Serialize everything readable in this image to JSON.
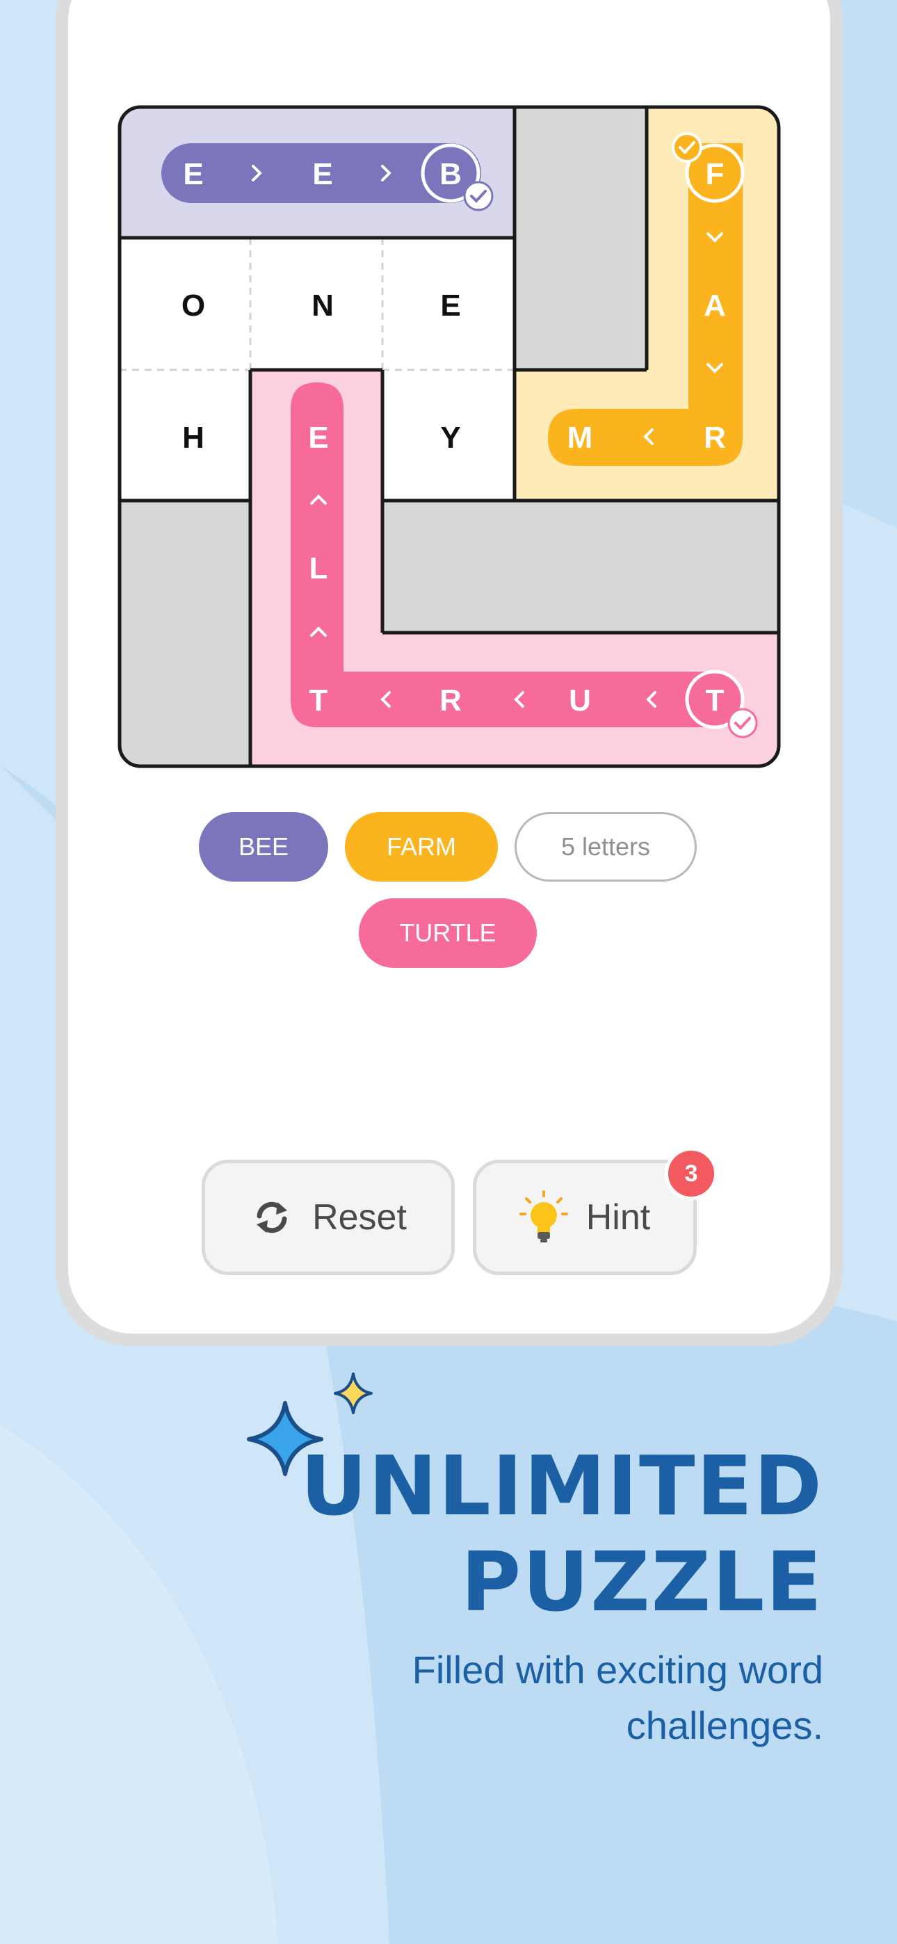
{
  "puzzle": {
    "grid_rows": [
      [
        "E",
        "",
        "E",
        "",
        "B",
        "",
        "F"
      ],
      [
        "O",
        "N",
        "E",
        "",
        "A"
      ],
      [
        "H",
        "E",
        "Y",
        "M",
        "R"
      ],
      [
        "L"
      ],
      [
        "T",
        "R",
        "U",
        "T"
      ]
    ],
    "words_found": [
      {
        "word": "BEE",
        "letters": [
          "E",
          "E",
          "B"
        ],
        "color": "#7b76bc",
        "region_color": "#d8d7ec",
        "checked": true
      },
      {
        "word": "FARM",
        "letters": [
          "F",
          "A",
          "R",
          "M"
        ],
        "color": "#fbb31e",
        "region_color": "#feebb8",
        "checked": true
      },
      {
        "word": "TURTLE",
        "letters": [
          "T",
          "U",
          "R",
          "T",
          "L",
          "E"
        ],
        "color": "#f76b9a",
        "region_color": "#fdd0df",
        "checked": true
      }
    ],
    "unplaced_letters": [
      "O",
      "N",
      "E",
      "H",
      "Y"
    ],
    "blocked_color": "#d8d8d8"
  },
  "chips": {
    "bee": "BEE",
    "farm": "FARM",
    "empty_hint": "5 letters",
    "turtle": "TURTLE"
  },
  "controls": {
    "reset_label": "Reset",
    "hint_label": "Hint",
    "hint_count": "3",
    "reset_icon": "refresh-icon",
    "hint_icon": "lightbulb-icon"
  },
  "promo": {
    "headline_line1": "UNLIMITED",
    "headline_line2": "PUZZLE",
    "subtitle": "Filled with exciting word challenges."
  },
  "colors": {
    "accent_blue": "#1b5fa5",
    "background": "#cfe6f8"
  }
}
